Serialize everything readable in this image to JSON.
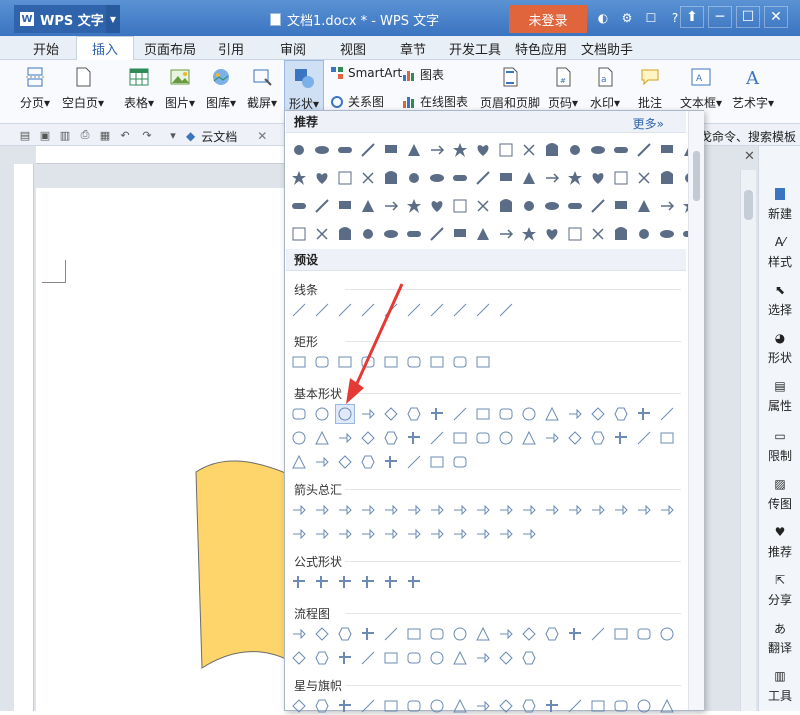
{
  "app": {
    "name": "WPS 文字",
    "logo_text": "W",
    "doc_title": "文档1.docx * - WPS 文字",
    "login": "未登录"
  },
  "tabs": [
    "开始",
    "插入",
    "页面布局",
    "引用",
    "审阅",
    "视图",
    "章节",
    "开发工具",
    "特色应用",
    "文档助手"
  ],
  "active_tab": "插入",
  "ribbon": {
    "blank_page": "分页▾",
    "empty_page": "空白页▾",
    "table": "表格▾",
    "picture": "图片▾",
    "gallery": "图库▾",
    "screenshot": "截屏▾",
    "shapes": "形状▾",
    "smartart": "SmartArt",
    "chart": "图表",
    "relation": "关系图",
    "online_chart": "在线图表",
    "header_footer": "页眉和页脚",
    "page_number": "页码▾",
    "watermark": "水印▾",
    "comment": "批注",
    "textbox": "文本框▾",
    "wordart": "艺术字▾"
  },
  "quickbar": {
    "doc_tab": "云文档",
    "hint": "戈命令、搜索模板"
  },
  "right_panel": [
    "新建",
    "样式",
    "选择",
    "形状",
    "属性",
    "限制",
    "传图",
    "推荐",
    "分享",
    "翻译",
    "工具"
  ],
  "menu": {
    "recommended": "推荐",
    "more": "更多»",
    "presets": "预设",
    "categories": [
      "线条",
      "矩形",
      "基本形状",
      "箭头总汇",
      "公式形状",
      "流程图",
      "星与旗帜"
    ]
  },
  "colors": {
    "accent": "#3b74c0",
    "login": "#e0653d",
    "shape_fill": "#fdd56a"
  }
}
